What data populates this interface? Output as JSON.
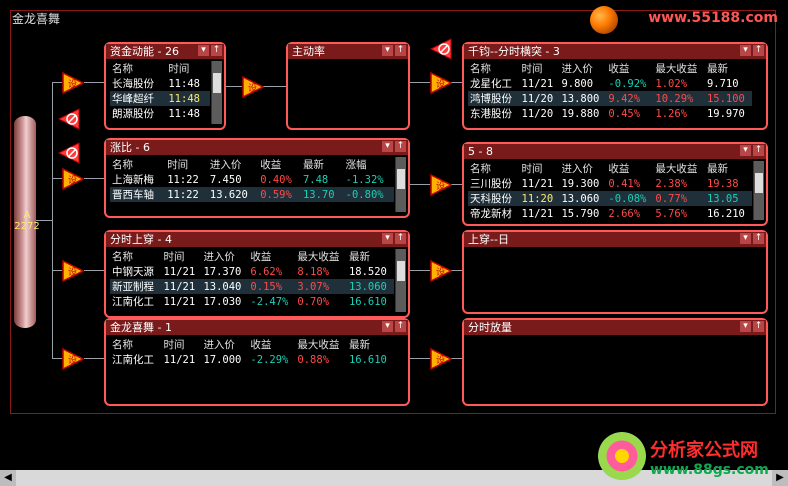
{
  "window": {
    "title": "金龙喜舞",
    "watermark": "www.55188.com"
  },
  "source": {
    "label": "A 2272"
  },
  "brand": {
    "name": "分析家公式网",
    "url": "www.88gs.com"
  },
  "colors": {
    "panel_border": "#ff5a5a",
    "header_bg": "#7a1b1b",
    "up": "#ff4a4a",
    "down": "#18d0b6"
  },
  "panels": {
    "zijindongneng": {
      "title": "资金动能 - 26",
      "headers": [
        "名称",
        "时间"
      ],
      "rows": [
        [
          "长海股份",
          "11:48"
        ],
        [
          "华峰超纤",
          "11:48"
        ],
        [
          "朗源股份",
          "11:48"
        ]
      ]
    },
    "zhudonglv": {
      "title": "主动率"
    },
    "zhangbi": {
      "title": "涨比 - 6",
      "headers": [
        "名称",
        "时间",
        "进入价",
        "收益",
        "最新",
        "涨幅"
      ],
      "rows": [
        [
          "上海新梅",
          "11:22",
          "7.450",
          "0.40%",
          "7.48",
          "-1.32%"
        ],
        [
          "晋西车轴",
          "11:22",
          "13.620",
          "0.59%",
          "13.70",
          "-0.80%"
        ]
      ]
    },
    "fenshishangchuan": {
      "title": "分时上穿 - 4",
      "headers": [
        "名称",
        "时间",
        "进入价",
        "收益",
        "最大收益",
        "最新"
      ],
      "rows": [
        [
          "中钢天源",
          "11/21",
          "17.370",
          "6.62%",
          "8.18%",
          "18.520"
        ],
        [
          "新亚制程",
          "11/21",
          "13.040",
          "0.15%",
          "3.07%",
          "13.060"
        ],
        [
          "江南化工",
          "11/21",
          "17.030",
          "-2.47%",
          "0.70%",
          "16.610"
        ]
      ]
    },
    "jinlongxiwu": {
      "title": "金龙喜舞 - 1",
      "headers": [
        "名称",
        "时间",
        "进入价",
        "收益",
        "最大收益",
        "最新"
      ],
      "rows": [
        [
          "江南化工",
          "11/21",
          "17.000",
          "-2.29%",
          "0.88%",
          "16.610"
        ]
      ]
    },
    "qianjun": {
      "title": "千钧--分时横突 - 3",
      "headers": [
        "名称",
        "时间",
        "进入价",
        "收益",
        "最大收益",
        "最新"
      ],
      "rows": [
        [
          "龙星化工",
          "11/21",
          "9.800",
          "-0.92%",
          "1.02%",
          "9.710"
        ],
        [
          "鸿博股份",
          "11/20",
          "13.800",
          "9.42%",
          "10.29%",
          "15.100"
        ],
        [
          "东港股份",
          "11/20",
          "19.880",
          "0.45%",
          "1.26%",
          "19.970"
        ]
      ]
    },
    "p5": {
      "title": "5 - 8",
      "headers": [
        "名称",
        "时间",
        "进入价",
        "收益",
        "最大收益",
        "最新"
      ],
      "rows": [
        [
          "三川股份",
          "11/21",
          "19.300",
          "0.41%",
          "2.38%",
          "19.38"
        ],
        [
          "天科股份",
          "11:20",
          "13.060",
          "-0.08%",
          "0.77%",
          "13.05"
        ],
        [
          "帝龙新材",
          "11/21",
          "15.790",
          "2.66%",
          "5.76%",
          "16.210"
        ]
      ]
    },
    "shangchuanri": {
      "title": "上穿--日"
    },
    "fenshifangliang": {
      "title": "分时放量"
    }
  },
  "nodes": {
    "setting_label": "设"
  }
}
